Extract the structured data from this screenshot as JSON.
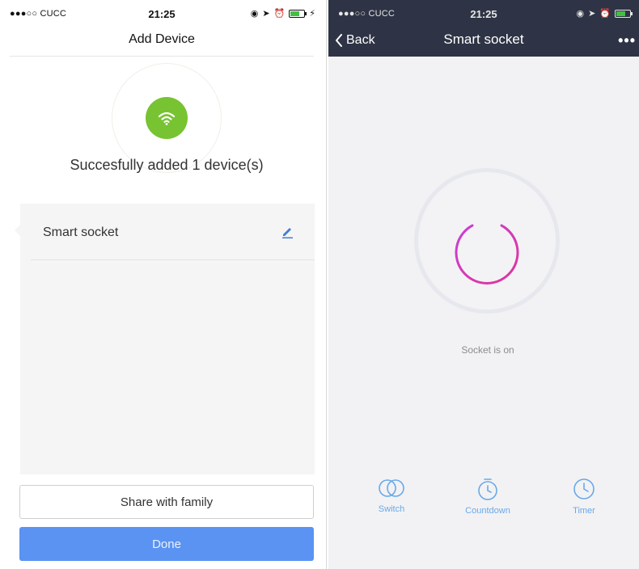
{
  "left": {
    "status": {
      "carrier": "●●●○○ CUCC",
      "time": "21:25"
    },
    "title": "Add Device",
    "success_text": "Succesfully added 1 device(s)",
    "device": {
      "name": "Smart socket"
    },
    "share_label": "Share with family",
    "done_label": "Done"
  },
  "right": {
    "status": {
      "carrier": "●●●○○ CUCC",
      "time": "21:25"
    },
    "back_label": "Back",
    "title": "Smart socket",
    "more_label": "•••",
    "socket_status": "Socket is on",
    "controls": [
      {
        "label": "Switch",
        "icon": "switch-icon"
      },
      {
        "label": "Countdown",
        "icon": "countdown-icon"
      },
      {
        "label": "Timer",
        "icon": "timer-icon"
      }
    ]
  },
  "colors": {
    "wifi_green": "#77c332",
    "done_blue": "#5a93f2",
    "topbar_dark": "#2e3445",
    "power_gradient_start": "#c93fd6",
    "power_gradient_end": "#e0349a",
    "control_blue": "#68a9e8"
  }
}
